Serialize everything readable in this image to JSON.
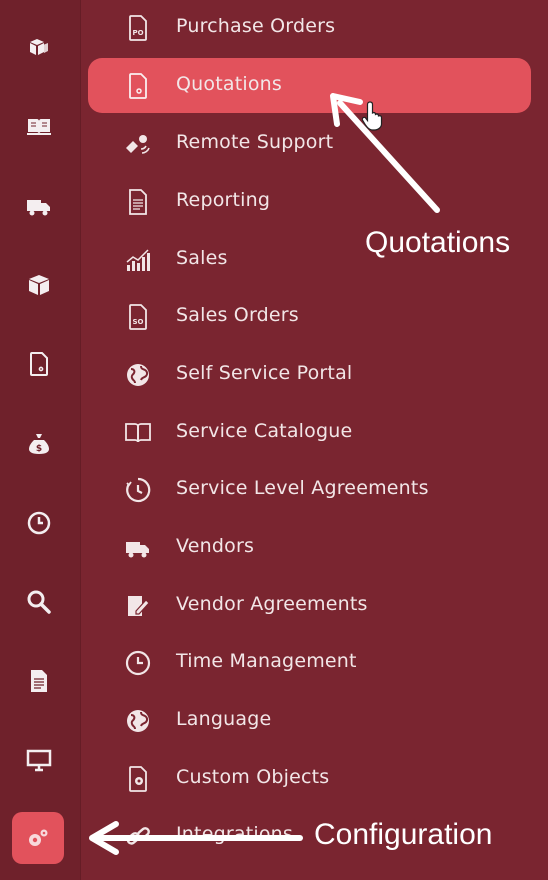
{
  "rail": {
    "icons": [
      {
        "name": "boxes-icon"
      },
      {
        "name": "book-icon"
      },
      {
        "name": "truck-icon"
      },
      {
        "name": "package-icon"
      },
      {
        "name": "quote-document-icon"
      },
      {
        "name": "money-bag-icon"
      },
      {
        "name": "clock-icon"
      },
      {
        "name": "search-icon"
      },
      {
        "name": "report-icon"
      },
      {
        "name": "monitor-icon"
      },
      {
        "name": "gear-icon"
      }
    ],
    "active": "gear-icon"
  },
  "menu": {
    "items": [
      {
        "label": "Purchase Orders",
        "icon": "po-document-icon"
      },
      {
        "label": "Quotations",
        "icon": "quote-document-icon",
        "selected": true
      },
      {
        "label": "Remote Support",
        "icon": "remote-support-icon"
      },
      {
        "label": "Reporting",
        "icon": "report-icon"
      },
      {
        "label": "Sales",
        "icon": "sales-chart-icon"
      },
      {
        "label": "Sales Orders",
        "icon": "so-document-icon"
      },
      {
        "label": "Self Service Portal",
        "icon": "globe-icon"
      },
      {
        "label": "Service Catalogue",
        "icon": "book-icon"
      },
      {
        "label": "Service Level Agreements",
        "icon": "timer-icon"
      },
      {
        "label": "Vendors",
        "icon": "truck-icon"
      },
      {
        "label": "Vendor Agreements",
        "icon": "edit-document-icon"
      },
      {
        "label": "Time Management",
        "icon": "clock-icon"
      },
      {
        "label": "Language",
        "icon": "globe-icon"
      },
      {
        "label": "Custom Objects",
        "icon": "custom-object-icon"
      },
      {
        "label": "Integrations",
        "icon": "link-icon"
      }
    ]
  },
  "annotations": {
    "quotations_label": "Quotations",
    "configuration_label": "Configuration"
  },
  "colors": {
    "background": "#7a2530",
    "rail": "#6f212b",
    "highlight": "#e2525c",
    "text": "#f2e6e7"
  }
}
